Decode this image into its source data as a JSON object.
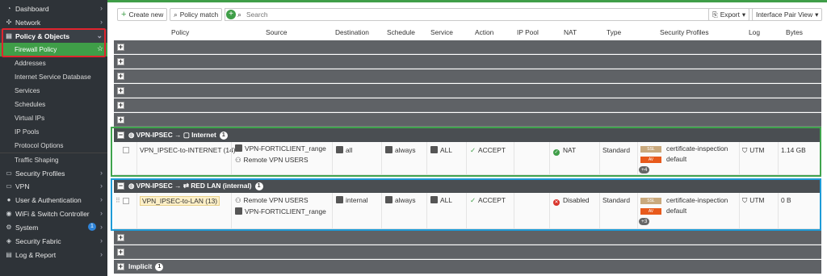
{
  "sidebar": {
    "items": [
      {
        "label": "Dashboard",
        "icon": "dashboard-icon"
      },
      {
        "label": "Network",
        "icon": "network-icon"
      },
      {
        "label": "Policy & Objects",
        "icon": "policy-icon"
      },
      {
        "label": "Firewall Policy"
      },
      {
        "label": "Addresses"
      },
      {
        "label": "Internet Service Database"
      },
      {
        "label": "Services"
      },
      {
        "label": "Schedules"
      },
      {
        "label": "Virtual IPs"
      },
      {
        "label": "IP Pools"
      },
      {
        "label": "Protocol Options"
      },
      {
        "label": "Traffic Shaping"
      },
      {
        "label": "Security Profiles",
        "icon": "security-profiles-icon"
      },
      {
        "label": "VPN",
        "icon": "vpn-icon"
      },
      {
        "label": "User & Authentication",
        "icon": "user-icon"
      },
      {
        "label": "WiFi & Switch Controller",
        "icon": "wifi-icon"
      },
      {
        "label": "System",
        "icon": "system-icon",
        "badge": "1"
      },
      {
        "label": "Security Fabric",
        "icon": "fabric-icon"
      },
      {
        "label": "Log & Report",
        "icon": "log-icon"
      }
    ]
  },
  "toolbar": {
    "create_new": "Create new",
    "policy_match": "Policy match",
    "search_placeholder": "Search",
    "export": "Export",
    "view": "Interface Pair View"
  },
  "columns": [
    "Policy",
    "Source",
    "Destination",
    "Schedule",
    "Service",
    "Action",
    "IP Pool",
    "NAT",
    "Type",
    "Security Profiles",
    "Log",
    "Bytes"
  ],
  "groups": {
    "g1": {
      "from": "VPN-IPSEC",
      "to": "Internet",
      "count": "1"
    },
    "g2": {
      "from": "VPN-IPSEC",
      "to": "RED LAN (internal)",
      "count": "1"
    },
    "implicit": {
      "label": "Implicit",
      "count": "1"
    }
  },
  "policies": [
    {
      "name": "VPN_IPSEC-to-INTERNET (14)",
      "source": [
        "VPN-FORTICLIENT_range",
        "Remote VPN USERS"
      ],
      "destination": "all",
      "schedule": "always",
      "service": "ALL",
      "action": "ACCEPT",
      "nat": "NAT",
      "type": "Standard",
      "profiles": [
        "certificate-inspection",
        "default"
      ],
      "profile_tags": [
        "SSL",
        "AV"
      ],
      "profiles_more": "+4",
      "log": "UTM",
      "bytes": "1.14 GB"
    },
    {
      "name": "VPN_IPSEC-to-LAN (13)",
      "source": [
        "Remote VPN USERS",
        "VPN-FORTICLIENT_range"
      ],
      "destination": "internal",
      "schedule": "always",
      "service": "ALL",
      "action": "ACCEPT",
      "nat": "Disabled",
      "type": "Standard",
      "profiles": [
        "certificate-inspection",
        "default"
      ],
      "profile_tags": [
        "SSL",
        "AV"
      ],
      "profiles_more": "+3",
      "log": "UTM",
      "bytes": "0 B"
    }
  ],
  "colors": {
    "accent": "#3f9e48",
    "sidebar_bg": "#2e3338",
    "highlight_red": "#e0242e",
    "highlight_green": "#3fa34d",
    "highlight_blue": "#1e9bd7"
  }
}
